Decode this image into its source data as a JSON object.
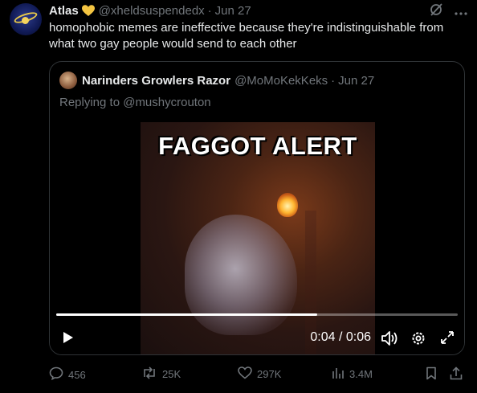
{
  "post": {
    "author_name": "Atlas",
    "author_handle": "@xheldsuspendedx",
    "separator": "·",
    "date": "Jun 27",
    "text": "homophobic memes are ineffective because they're indistinguishable from what two gay people would send to each other"
  },
  "quote": {
    "author_name": "Narinders Growlers Razor",
    "author_handle": "@MoMoKekKeks",
    "separator": "·",
    "date": "Jun 27",
    "replying_to": "Replying to @mushycrouton",
    "video": {
      "caption": "FAGGOT ALERT",
      "current_time": "0:04",
      "time_sep": "/",
      "duration": "0:06",
      "progress_fraction": 0.65
    }
  },
  "actions": {
    "replies": "456",
    "reposts": "25K",
    "likes": "297K",
    "views": "3.4M"
  },
  "icons": {
    "verified": "heart-icon",
    "grok": "grok-icon",
    "more": "more-icon",
    "reply": "reply-icon",
    "repost": "repost-icon",
    "like": "like-icon",
    "views": "views-icon",
    "bookmark": "bookmark-icon",
    "share": "share-icon",
    "play": "play-icon",
    "volume": "volume-icon",
    "settings": "settings-icon",
    "fullscreen": "fullscreen-icon"
  },
  "colors": {
    "background": "#000000",
    "text": "#e7e9ea",
    "muted": "#71767b",
    "border": "#2f3336",
    "heart": "#f4c542"
  }
}
